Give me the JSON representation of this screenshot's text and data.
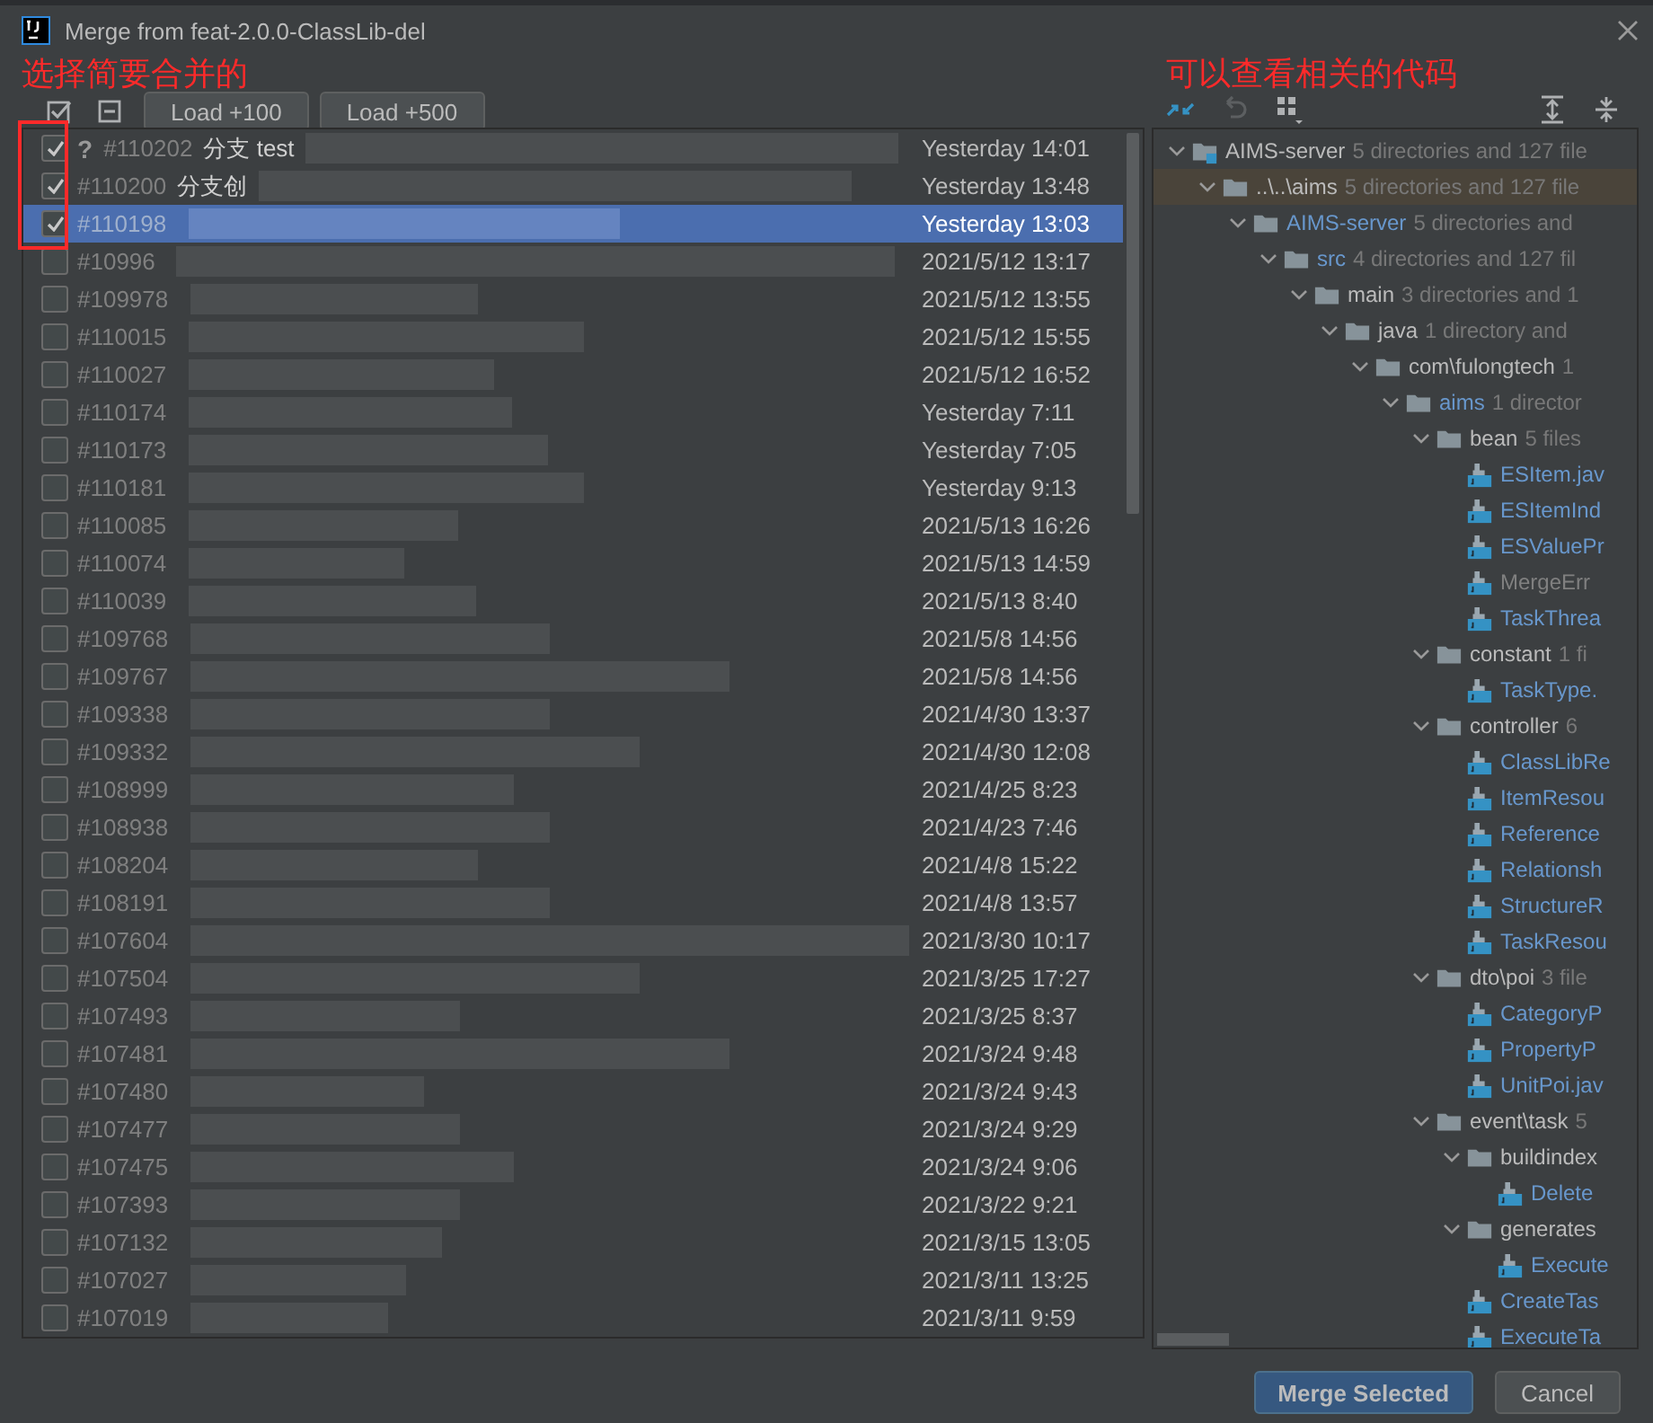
{
  "window": {
    "title": "Merge from feat-2.0.0-ClassLib-del"
  },
  "annotations": [
    {
      "text": "选择简要合并的"
    },
    {
      "text": "可以查看相关的代码"
    }
  ],
  "load_buttons": [
    "Load +100",
    "Load +500"
  ],
  "commits": [
    {
      "id": "#110202",
      "prefix": "?",
      "message": "分支 test",
      "date": "Yesterday 14:01",
      "checked": true,
      "selected": false
    },
    {
      "id": "#110200",
      "message": "分支创",
      "date": "Yesterday 13:48",
      "checked": true,
      "selected": false
    },
    {
      "id": "#110198",
      "date": "Yesterday 13:03",
      "checked": true,
      "selected": true
    },
    {
      "id": "#10996",
      "date": "2021/5/12 13:17",
      "checked": false,
      "selected": false
    },
    {
      "id": "#109978",
      "date": "2021/5/12 13:55",
      "checked": false,
      "selected": false
    },
    {
      "id": "#110015",
      "date": "2021/5/12 15:55",
      "checked": false,
      "selected": false
    },
    {
      "id": "#110027",
      "date": "2021/5/12 16:52",
      "checked": false,
      "selected": false
    },
    {
      "id": "#110174",
      "date": "Yesterday 7:11",
      "checked": false,
      "selected": false
    },
    {
      "id": "#110173",
      "date": "Yesterday 7:05",
      "checked": false,
      "selected": false
    },
    {
      "id": "#110181",
      "date": "Yesterday 9:13",
      "checked": false,
      "selected": false
    },
    {
      "id": "#110085",
      "date": "2021/5/13 16:26",
      "checked": false,
      "selected": false
    },
    {
      "id": "#110074",
      "date": "2021/5/13 14:59",
      "checked": false,
      "selected": false
    },
    {
      "id": "#110039",
      "date": "2021/5/13 8:40",
      "checked": false,
      "selected": false
    },
    {
      "id": "#109768",
      "date": "2021/5/8 14:56",
      "checked": false,
      "selected": false
    },
    {
      "id": "#109767",
      "date": "2021/5/8 14:56",
      "checked": false,
      "selected": false
    },
    {
      "id": "#109338",
      "date": "2021/4/30 13:37",
      "checked": false,
      "selected": false
    },
    {
      "id": "#109332",
      "date": "2021/4/30 12:08",
      "checked": false,
      "selected": false
    },
    {
      "id": "#108999",
      "date": "2021/4/25 8:23",
      "checked": false,
      "selected": false
    },
    {
      "id": "#108938",
      "date": "2021/4/23 7:46",
      "checked": false,
      "selected": false
    },
    {
      "id": "#108204",
      "date": "2021/4/8 15:22",
      "checked": false,
      "selected": false
    },
    {
      "id": "#108191",
      "date": "2021/4/8 13:57",
      "checked": false,
      "selected": false
    },
    {
      "id": "#107604",
      "date": "2021/3/30 10:17",
      "checked": false,
      "selected": false
    },
    {
      "id": "#107504",
      "date": "2021/3/25 17:27",
      "checked": false,
      "selected": false
    },
    {
      "id": "#107493",
      "date": "2021/3/25 8:37",
      "checked": false,
      "selected": false
    },
    {
      "id": "#107481",
      "date": "2021/3/24 9:48",
      "checked": false,
      "selected": false
    },
    {
      "id": "#107480",
      "date": "2021/3/24 9:43",
      "checked": false,
      "selected": false
    },
    {
      "id": "#107477",
      "date": "2021/3/24 9:29",
      "checked": false,
      "selected": false
    },
    {
      "id": "#107475",
      "date": "2021/3/24 9:06",
      "checked": false,
      "selected": false
    },
    {
      "id": "#107393",
      "date": "2021/3/22 9:21",
      "checked": false,
      "selected": false
    },
    {
      "id": "#107132",
      "date": "2021/3/15 13:05",
      "checked": false,
      "selected": false
    },
    {
      "id": "#107027",
      "date": "2021/3/11 13:25",
      "checked": false,
      "selected": false
    },
    {
      "id": "#107019",
      "date": "2021/3/11 9:59",
      "checked": false,
      "selected": false
    }
  ],
  "changes_tree": [
    {
      "kind": "module",
      "name": "AIMS-server",
      "info": "5 directories and 127 file",
      "color": "#bbbbbb",
      "selected": false,
      "expanded": true,
      "children": [
        {
          "kind": "folder",
          "name": "..\\..\\aims",
          "info": "5 directories and 127 file",
          "color": "#bbbbbb",
          "selected": true,
          "expanded": true,
          "children": [
            {
              "kind": "folder",
              "name": "AIMS-server",
              "info": "5 directories and",
              "color": "#6897cc",
              "selected": false,
              "expanded": true,
              "children": [
                {
                  "kind": "folder",
                  "name": "src",
                  "info": "4 directories and 127 fil",
                  "color": "#6897cc",
                  "selected": false,
                  "expanded": true,
                  "children": [
                    {
                      "kind": "folder",
                      "name": "main",
                      "info": "3 directories and 1",
                      "color": "#bbbbbb",
                      "selected": false,
                      "expanded": true,
                      "children": [
                        {
                          "kind": "folder",
                          "name": "java",
                          "info": "1 directory and",
                          "color": "#bbbbbb",
                          "selected": false,
                          "expanded": true,
                          "children": [
                            {
                              "kind": "folder",
                              "name": "com\\fulongtech",
                              "info": "1",
                              "color": "#bbbbbb",
                              "selected": false,
                              "expanded": true,
                              "children": [
                                {
                                  "kind": "folder",
                                  "name": "aims",
                                  "info": "1 director",
                                  "color": "#6897cc",
                                  "selected": false,
                                  "expanded": true,
                                  "children": [
                                    {
                                      "kind": "folder",
                                      "name": "bean",
                                      "info": "5 files",
                                      "color": "#bbbbbb",
                                      "selected": false,
                                      "expanded": true,
                                      "children": [
                                        {
                                          "kind": "file",
                                          "name": "ESItem.jav",
                                          "color": "#6897cc",
                                          "selected": false
                                        },
                                        {
                                          "kind": "file",
                                          "name": "ESItemInd",
                                          "color": "#6897cc",
                                          "selected": false
                                        },
                                        {
                                          "kind": "file",
                                          "name": "ESValuePr",
                                          "color": "#6897cc",
                                          "selected": false
                                        },
                                        {
                                          "kind": "file",
                                          "name": "MergeErr",
                                          "color": "#808080",
                                          "selected": false
                                        },
                                        {
                                          "kind": "file",
                                          "name": "TaskThrea",
                                          "color": "#6897cc",
                                          "selected": false
                                        }
                                      ]
                                    },
                                    {
                                      "kind": "folder",
                                      "name": "constant",
                                      "info": "1 fi",
                                      "color": "#bbbbbb",
                                      "selected": false,
                                      "expanded": true,
                                      "children": [
                                        {
                                          "kind": "file",
                                          "name": "TaskType.",
                                          "color": "#6897cc",
                                          "selected": false
                                        }
                                      ]
                                    },
                                    {
                                      "kind": "folder",
                                      "name": "controller",
                                      "info": "6",
                                      "color": "#bbbbbb",
                                      "selected": false,
                                      "expanded": true,
                                      "children": [
                                        {
                                          "kind": "file",
                                          "name": "ClassLibRe",
                                          "color": "#6897cc",
                                          "selected": false
                                        },
                                        {
                                          "kind": "file",
                                          "name": "ItemResou",
                                          "color": "#6897cc",
                                          "selected": false
                                        },
                                        {
                                          "kind": "file",
                                          "name": "Reference",
                                          "color": "#6897cc",
                                          "selected": false
                                        },
                                        {
                                          "kind": "file",
                                          "name": "Relationsh",
                                          "color": "#6897cc",
                                          "selected": false
                                        },
                                        {
                                          "kind": "file",
                                          "name": "StructureR",
                                          "color": "#6897cc",
                                          "selected": false
                                        },
                                        {
                                          "kind": "file",
                                          "name": "TaskResou",
                                          "color": "#6897cc",
                                          "selected": false
                                        }
                                      ]
                                    },
                                    {
                                      "kind": "folder",
                                      "name": "dto\\poi",
                                      "info": "3 file",
                                      "color": "#bbbbbb",
                                      "selected": false,
                                      "expanded": true,
                                      "children": [
                                        {
                                          "kind": "file",
                                          "name": "CategoryP",
                                          "color": "#6897cc",
                                          "selected": false
                                        },
                                        {
                                          "kind": "file",
                                          "name": "PropertyP",
                                          "color": "#6897cc",
                                          "selected": false
                                        },
                                        {
                                          "kind": "file",
                                          "name": "UnitPoi.jav",
                                          "color": "#6897cc",
                                          "selected": false
                                        }
                                      ]
                                    },
                                    {
                                      "kind": "folder",
                                      "name": "event\\task",
                                      "info": "5",
                                      "color": "#bbbbbb",
                                      "selected": false,
                                      "expanded": true,
                                      "children": [
                                        {
                                          "kind": "folder",
                                          "name": "buildindex",
                                          "color": "#bbbbbb",
                                          "selected": false,
                                          "expanded": true,
                                          "children": [
                                            {
                                              "kind": "file",
                                              "name": "Delete",
                                              "color": "#6897cc",
                                              "selected": false
                                            }
                                          ]
                                        },
                                        {
                                          "kind": "folder",
                                          "name": "generates",
                                          "color": "#bbbbbb",
                                          "selected": false,
                                          "expanded": true,
                                          "children": [
                                            {
                                              "kind": "file",
                                              "name": "Execute",
                                              "color": "#6897cc",
                                              "selected": false
                                            }
                                          ]
                                        },
                                        {
                                          "kind": "file",
                                          "name": "CreateTas",
                                          "color": "#6897cc",
                                          "selected": false
                                        },
                                        {
                                          "kind": "file",
                                          "name": "ExecuteTa",
                                          "color": "#6897cc",
                                          "selected": false
                                        }
                                      ]
                                    }
                                  ]
                                }
                              ]
                            }
                          ]
                        }
                      ]
                    }
                  ]
                }
              ]
            }
          ]
        }
      ]
    }
  ],
  "buttons": [
    {
      "label": "Merge Selected",
      "kind": "primary"
    },
    {
      "label": "Cancel",
      "kind": "secondary"
    }
  ]
}
